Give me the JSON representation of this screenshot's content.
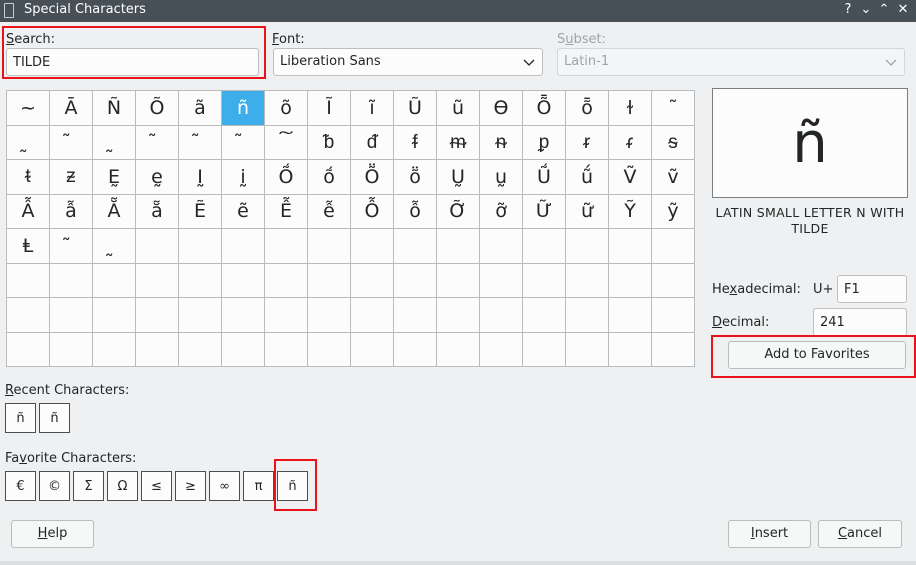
{
  "window": {
    "title": "Special Characters",
    "help_glyph": "?",
    "minimize_glyph": "⌄",
    "maximize_glyph": "⌃",
    "close_glyph": "✕"
  },
  "search": {
    "label_key": "S",
    "label_rest": "earch:",
    "value": "TILDE"
  },
  "font": {
    "label_key": "F",
    "label_rest": "ont:",
    "value": "Liberation Sans"
  },
  "subset": {
    "label_pre": "S",
    "label_key": "u",
    "label_rest": "bset:",
    "value": "Latin-1"
  },
  "grid": {
    "rows": [
      [
        "~",
        "Ā",
        "Ñ",
        "Õ",
        "ã",
        "ñ",
        "õ",
        "Ĩ",
        "ĩ",
        "Ũ",
        "ũ",
        "Ɵ",
        "Ȭ",
        "ȭ",
        "ɫ",
        "˜"
      ],
      [
        "̰",
        "̃",
        "̰",
        "͂",
        "̃",
        "̃",
        "͠",
        "ᵬ",
        "ᵭ",
        "ᵮ",
        "ᵯ",
        "ᵰ",
        "ᵱ",
        "ᵲ",
        "ᵳ",
        "ᵴ"
      ],
      [
        "ᵵ",
        "ᵶ",
        "Ḛ",
        "ḛ",
        "Ḭ",
        "ḭ",
        "Ṍ",
        "ṍ",
        "Ṏ",
        "ṏ",
        "Ṵ",
        "ṵ",
        "Ṹ",
        "ṹ",
        "Ṽ",
        "ṽ"
      ],
      [
        "Ẫ",
        "ẫ",
        "Ẵ",
        "ẵ",
        "Ẽ",
        "ẽ",
        "Ễ",
        "ễ",
        "Ỗ",
        "ỗ",
        "Ỡ",
        "ỡ",
        "Ữ",
        "ữ",
        "Ỹ",
        "ỹ"
      ],
      [
        "Ⱡ",
        "̃",
        "̰",
        "",
        "",
        "",
        "",
        "",
        "",
        "",
        "",
        "",
        "",
        "",
        "",
        ""
      ],
      [
        "",
        "",
        "",
        "",
        "",
        "",
        "",
        "",
        "",
        "",
        "",
        "",
        "",
        "",
        "",
        ""
      ],
      [
        "",
        "",
        "",
        "",
        "",
        "",
        "",
        "",
        "",
        "",
        "",
        "",
        "",
        "",
        "",
        ""
      ],
      [
        "",
        "",
        "",
        "",
        "",
        "",
        "",
        "",
        "",
        "",
        "",
        "",
        "",
        "",
        "",
        ""
      ]
    ],
    "selected_row": 0,
    "selected_col": 5
  },
  "preview": {
    "glyph": "ñ",
    "name": "LATIN SMALL LETTER N WITH TILDE"
  },
  "hex": {
    "label_pre": "He",
    "label_key": "x",
    "label_rest": "adecimal:",
    "prefix": "U+",
    "value": "F1"
  },
  "decimal": {
    "label_key": "D",
    "label_rest": "ecimal:",
    "value": "241"
  },
  "add_favorites_label": "Add to Favorites",
  "recent": {
    "label_key": "R",
    "label_rest": "ecent Characters:",
    "chars": [
      "ñ",
      "ñ"
    ]
  },
  "favorites": {
    "label_pre": "Fa",
    "label_key": "v",
    "label_rest": "orite Characters:",
    "chars": [
      "€",
      "©",
      "Σ",
      "Ω",
      "≤",
      "≥",
      "∞",
      "π",
      "ñ"
    ]
  },
  "buttons": {
    "help_key": "H",
    "help_rest": "elp",
    "insert_key": "I",
    "insert_rest": "nsert",
    "cancel_key": "C",
    "cancel_rest": "ancel"
  },
  "colors": {
    "selection": "#3daee9",
    "highlight": "#e8141a",
    "titlebar": "#475057"
  }
}
